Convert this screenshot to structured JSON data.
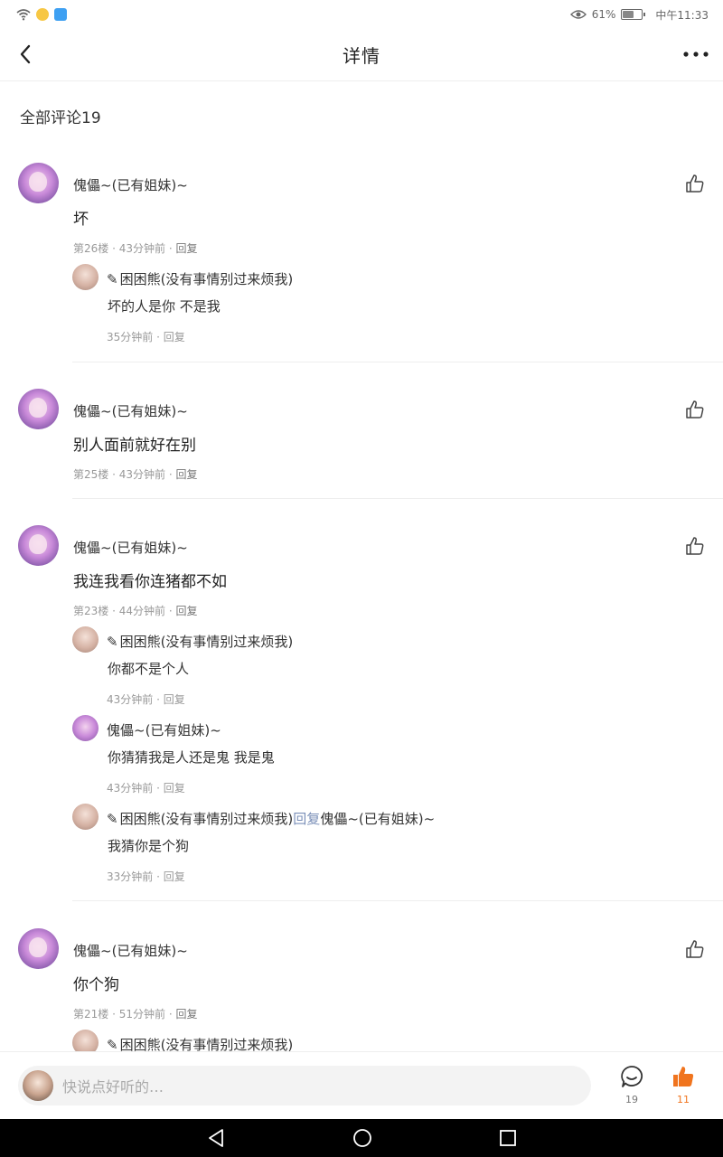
{
  "status_bar": {
    "percent": "61%",
    "time": "中午11:33",
    "battery_level": 0.61
  },
  "app_bar": {
    "title": "详情",
    "back_icon": "chevron-left-icon",
    "more_icon": "more-horizontal-icon"
  },
  "section": {
    "title": "全部评论19"
  },
  "comments": [
    {
      "username": "傀儡~(已有姐妹)~",
      "content": "坏",
      "floor": "第26楼",
      "time": "43分钟前",
      "reply_label": "回复",
      "replies": [
        {
          "name": "困困熊(没有事情别过来烦我)",
          "pencil": "✎",
          "reply_word": "",
          "target": "",
          "content": "坏的人是你 不是我",
          "time": "35分钟前",
          "reply_label": "回复"
        }
      ]
    },
    {
      "username": "傀儡~(已有姐妹)~",
      "content": "别人面前就好在别",
      "floor": "第25楼",
      "time": "43分钟前",
      "reply_label": "回复",
      "replies": []
    },
    {
      "username": "傀儡~(已有姐妹)~",
      "content": "我连我看你连猪都不如",
      "floor": "第23楼",
      "time": "44分钟前",
      "reply_label": "回复",
      "replies": [
        {
          "name": "困困熊(没有事情别过来烦我)",
          "pencil": "✎",
          "reply_word": "",
          "target": "",
          "content": "你都不是个人",
          "time": "43分钟前",
          "reply_label": "回复"
        },
        {
          "name": "傀儡~(已有姐妹)~",
          "pencil": "",
          "reply_word": "",
          "target": "",
          "content": "你猜猜我是人还是鬼 我是鬼",
          "time": "43分钟前",
          "reply_label": "回复"
        },
        {
          "name": "困困熊(没有事情别过来烦我)",
          "pencil": "✎",
          "reply_word": "回复",
          "target": "傀儡~(已有姐妹)~",
          "content": "我猜你是个狗",
          "time": "33分钟前",
          "reply_label": "回复"
        }
      ]
    },
    {
      "username": "傀儡~(已有姐妹)~",
      "content": "你个狗",
      "floor": "第21楼",
      "time": "51分钟前",
      "reply_label": "回复",
      "replies": [
        {
          "name": "困困熊(没有事情别过来烦我)",
          "pencil": "✎",
          "reply_word": "",
          "target": "",
          "content": "",
          "time": "",
          "reply_label": ""
        }
      ]
    }
  ],
  "bottom_bar": {
    "placeholder": "快说点好听的…",
    "comment_count": "19",
    "like_count": "11"
  },
  "colors": {
    "accent_orange": "#f0741e",
    "text": "#222222",
    "muted": "#999999",
    "divider": "#eeeeee"
  }
}
